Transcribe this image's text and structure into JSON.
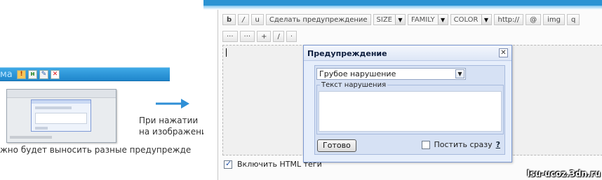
{
  "left": {
    "bar_tail": "ма",
    "icons": [
      "warning-icon",
      "edit-icon",
      "pencil-icon",
      "delete-icon"
    ],
    "hint_line1": "При нажатии",
    "hint_line2": "на изображение",
    "caption": "жно будет выносить разные предупрежде"
  },
  "editor": {
    "toolbar": [
      "b",
      "/",
      "u",
      "Сделать предупреждение",
      "SIZE",
      "FAMILY",
      "COLOR",
      "http://",
      "@",
      "img",
      "q"
    ],
    "toolbar2": [
      "···",
      "···",
      "+",
      "/",
      "·"
    ],
    "html_label": "Включить HTML теги",
    "html_checked": true
  },
  "dialog": {
    "title": "Предупреждение",
    "close": "✕",
    "reason_selected": "Грубое нарушение",
    "violation_legend": "Текст нарушения",
    "violation_value": "",
    "ok_label": "Готово",
    "post_now_label": "Постить сразу",
    "help": "?"
  },
  "watermark": "lsu-ucoz.3dn.ru",
  "colors": {
    "accent": "#2a93d3",
    "arrow": "#2f8fd6",
    "dialog_bg": "#e6eefb"
  }
}
